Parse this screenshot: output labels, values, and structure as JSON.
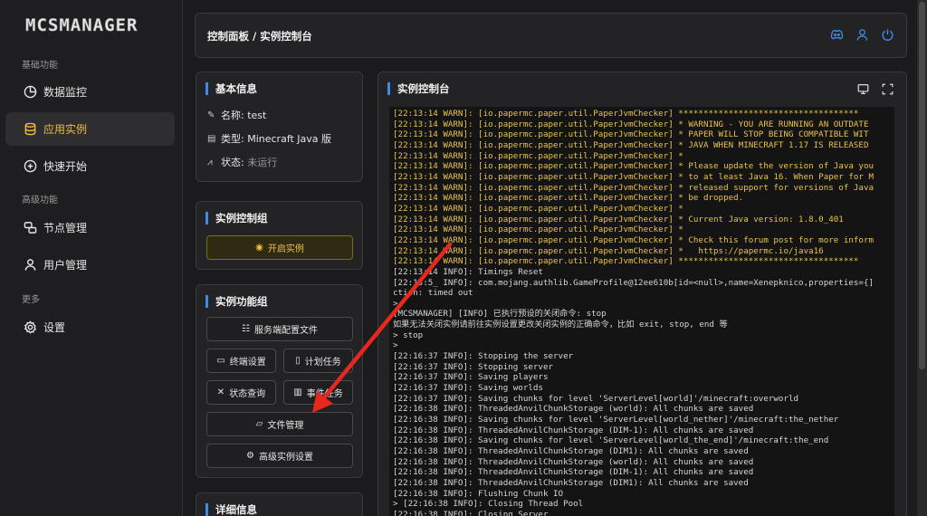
{
  "app": {
    "logo": "MCSMANAGER"
  },
  "sidebar": {
    "groups": [
      "基础功能",
      "高级功能",
      "更多"
    ],
    "items": [
      {
        "label": "数据监控",
        "icon": "dashboard-icon"
      },
      {
        "label": "应用实例",
        "icon": "database-icon"
      },
      {
        "label": "快速开始",
        "icon": "plus-circle-icon"
      },
      {
        "label": "节点管理",
        "icon": "nodes-icon"
      },
      {
        "label": "用户管理",
        "icon": "user-icon"
      },
      {
        "label": "设置",
        "icon": "gear-icon"
      }
    ]
  },
  "header": {
    "breadcrumb": "控制面板 / 实例控制台",
    "icons": [
      "discord-icon",
      "user-icon",
      "power-icon"
    ]
  },
  "basic_info": {
    "title": "基本信息",
    "name_label": "名称:",
    "name_value": "test",
    "type_label": "类型:",
    "type_value": "Minecraft Java 版",
    "status_label": "状态:",
    "status_value": "未运行"
  },
  "control_group": {
    "title": "实例控制组",
    "start_label": "开启实例"
  },
  "function_group": {
    "title": "实例功能组",
    "server_config": "服务端配置文件",
    "terminal_settings": "终端设置",
    "scheduled_tasks": "计划任务",
    "status_query": "状态查询",
    "event_tasks": "事件任务",
    "file_manager": "文件管理",
    "advanced_settings": "高级实例设置"
  },
  "details": {
    "title": "详细信息"
  },
  "console": {
    "title": "实例控制台",
    "lines": [
      {
        "t": "[22:13:14 WARN]: [io.papermc.paper.util.PaperJvmChecker] ************************************",
        "w": true
      },
      {
        "t": "[22:13:14 WARN]: [io.papermc.paper.util.PaperJvmChecker] * WARNING - YOU ARE RUNNING AN OUTDATE",
        "w": true
      },
      {
        "t": "[22:13:14 WARN]: [io.papermc.paper.util.PaperJvmChecker] * PAPER WILL STOP BEING COMPATIBLE WIT",
        "w": true
      },
      {
        "t": "[22:13:14 WARN]: [io.papermc.paper.util.PaperJvmChecker] * JAVA WHEN MINECRAFT 1.17 IS RELEASED",
        "w": true
      },
      {
        "t": "[22:13:14 WARN]: [io.papermc.paper.util.PaperJvmChecker] *",
        "w": true
      },
      {
        "t": "[22:13:14 WARN]: [io.papermc.paper.util.PaperJvmChecker] * Please update the version of Java you",
        "w": true
      },
      {
        "t": "[22:13:14 WARN]: [io.papermc.paper.util.PaperJvmChecker] * to at least Java 16. When Paper for M",
        "w": true
      },
      {
        "t": "[22:13:14 WARN]: [io.papermc.paper.util.PaperJvmChecker] * released support for versions of Java",
        "w": true
      },
      {
        "t": "[22:13:14 WARN]: [io.papermc.paper.util.PaperJvmChecker] * be dropped.",
        "w": true
      },
      {
        "t": "[22:13:14 WARN]: [io.papermc.paper.util.PaperJvmChecker] *",
        "w": true
      },
      {
        "t": "[22:13:14 WARN]: [io.papermc.paper.util.PaperJvmChecker] * Current Java version: 1.8.0_401",
        "w": true
      },
      {
        "t": "[22:13:14 WARN]: [io.papermc.paper.util.PaperJvmChecker] *",
        "w": true
      },
      {
        "t": "[22:13:14 WARN]: [io.papermc.paper.util.PaperJvmChecker] * Check this forum post for more inform",
        "w": true
      },
      {
        "t": "[22:13:14 WARN]: [io.papermc.paper.util.PaperJvmChecker] *   https://papermc.io/java16",
        "w": true
      },
      {
        "t": "[22:13:14 WARN]: [io.papermc.paper.util.PaperJvmChecker] ************************************",
        "w": true
      },
      {
        "t": "[22:13:14 INFO]: Timings Reset",
        "w": false
      },
      {
        "t": "[22:13:5_ INFO]: com.mojang.authlib.GameProfile@12ee610b[id=<null>,name=Xenepknico,properties={]",
        "w": false
      },
      {
        "t": "ction: timed out",
        "w": false
      },
      {
        "t": ">",
        "w": false
      },
      {
        "t": "[MCSMANAGER] [INFO] 已执行预设的关闭命令: stop",
        "w": false
      },
      {
        "t": "如果无法关闭实例请前往实例设置更改关闭实例的正确命令，比如 exit, stop, end 等",
        "w": false
      },
      {
        "t": "> stop",
        "w": false
      },
      {
        "t": ">",
        "w": false
      },
      {
        "t": "[22:16:37 INFO]: Stopping the server",
        "w": false
      },
      {
        "t": "[22:16:37 INFO]: Stopping server",
        "w": false
      },
      {
        "t": "[22:16:37 INFO]: Saving players",
        "w": false
      },
      {
        "t": "[22:16:37 INFO]: Saving worlds",
        "w": false
      },
      {
        "t": "[22:16:37 INFO]: Saving chunks for level 'ServerLevel[world]'/minecraft:overworld",
        "w": false
      },
      {
        "t": "[22:16:38 INFO]: ThreadedAnvilChunkStorage (world): All chunks are saved",
        "w": false
      },
      {
        "t": "[22:16:38 INFO]: Saving chunks for level 'ServerLevel[world_nether]'/minecraft:the_nether",
        "w": false
      },
      {
        "t": "[22:16:38 INFO]: ThreadedAnvilChunkStorage (DIM-1): All chunks are saved",
        "w": false
      },
      {
        "t": "[22:16:38 INFO]: Saving chunks for level 'ServerLevel[world_the_end]'/minecraft:the_end",
        "w": false
      },
      {
        "t": "[22:16:38 INFO]: ThreadedAnvilChunkStorage (DIM1): All chunks are saved",
        "w": false
      },
      {
        "t": "[22:16:38 INFO]: ThreadedAnvilChunkStorage (world): All chunks are saved",
        "w": false
      },
      {
        "t": "[22:16:38 INFO]: ThreadedAnvilChunkStorage (DIM-1): All chunks are saved",
        "w": false
      },
      {
        "t": "[22:16:38 INFO]: ThreadedAnvilChunkStorage (DIM1): All chunks are saved",
        "w": false
      },
      {
        "t": "[22:16:38 INFO]: Flushing Chunk IO",
        "w": false
      },
      {
        "t": "> [22:16:38 INFO]: Closing Thread Pool",
        "w": false
      },
      {
        "t": "[22:16:38 INFO]: Closing Server",
        "w": false
      }
    ]
  },
  "colors": {
    "accent": "#3d8de8",
    "active": "#f0b840",
    "warn": "#e8c34a",
    "annotation_arrow": "#e8281e"
  }
}
